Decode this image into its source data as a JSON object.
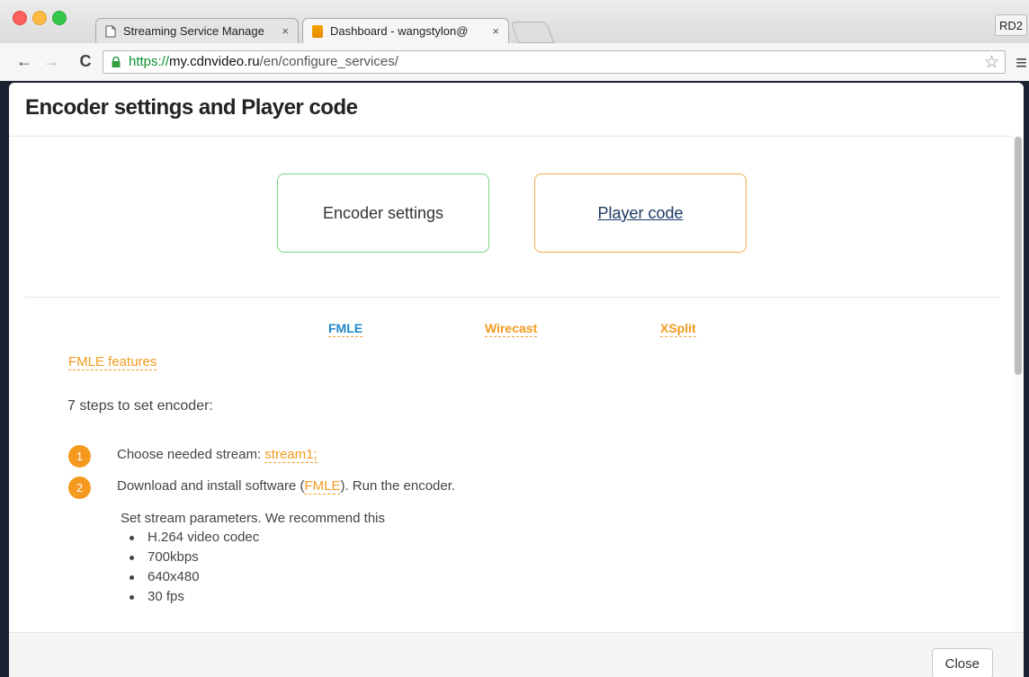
{
  "browser": {
    "tabs": [
      {
        "title": "Streaming Service Manage",
        "close": "×"
      },
      {
        "title": "Dashboard - wangstylon@",
        "close": "×"
      }
    ],
    "profile_label": "RD2",
    "url": {
      "protocol": "https://",
      "host": "my.cdnvideo.ru",
      "path": "/en/configure_services/"
    }
  },
  "modal": {
    "title": "Encoder settings and Player code",
    "mode_buttons": {
      "encoder": "Encoder settings",
      "player": "Player code"
    },
    "encoder_tabs": [
      "FMLE",
      "Wirecast",
      "XSplit"
    ],
    "features_link": "FMLE features",
    "steps_intro": "7 steps to set encoder:",
    "steps": [
      {
        "number": "1",
        "text_before": "Choose needed stream: ",
        "link": "stream1;",
        "text_after": ""
      },
      {
        "number": "2",
        "text_before": "Download and install software (",
        "link": "FMLE",
        "text_after": "). Run the encoder."
      }
    ],
    "params_intro": "Set stream parameters. We recommend this",
    "params": [
      "H.264 video codec",
      "700kbps",
      "640x480",
      "30 fps"
    ],
    "close_label": "Close"
  },
  "colors": {
    "accent_orange": "#f39a1f",
    "accent_blue": "#1e86c9",
    "accent_green": "#7bd47b",
    "backdrop": "#1b2231"
  }
}
